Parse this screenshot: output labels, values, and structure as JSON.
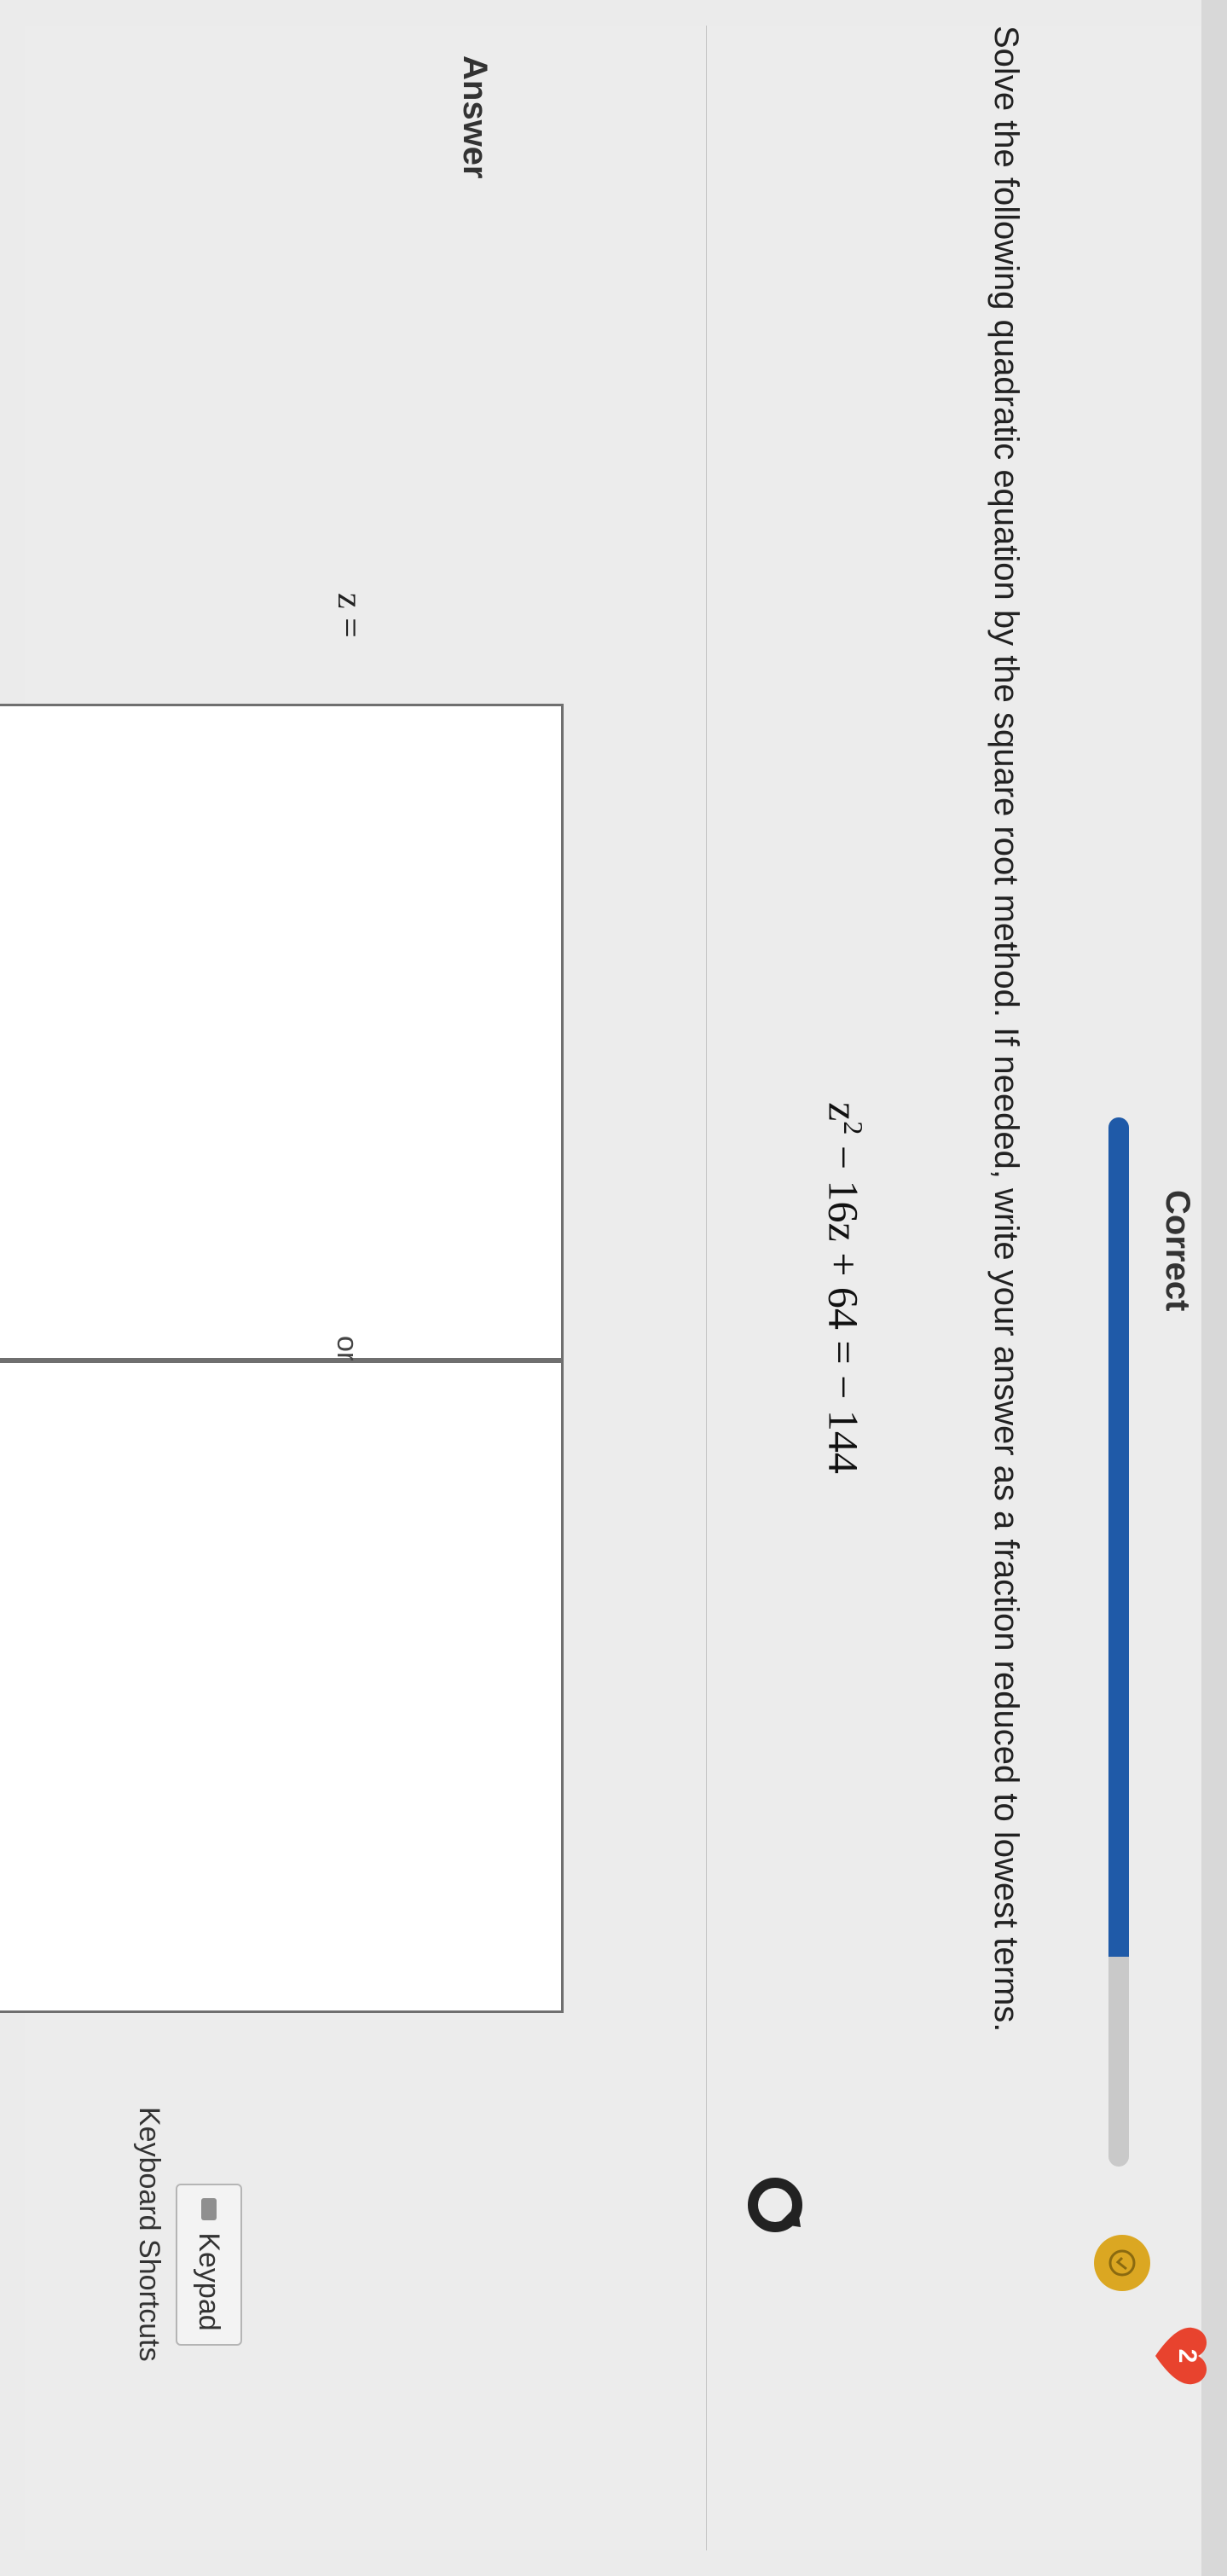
{
  "header": {
    "status": "Correct",
    "progress": 0.8,
    "heart_count": "2",
    "colors": {
      "progress_fill": "#1f5aa8",
      "badge": "#dba722",
      "heart": "#e8432e"
    }
  },
  "question": {
    "text": "Solve the following quadratic equation by the square root method. If needed, write your answer as a fraction reduced to lowest terms.",
    "equation": {
      "base": "z",
      "exponent": "2",
      "rest": " − 16z + 64 = − 144"
    }
  },
  "answer": {
    "label": "Answer",
    "variable_label": "z =",
    "separator": "or",
    "input1_value": "",
    "input2_value": ""
  },
  "tools": {
    "keypad_label": "Keypad",
    "shortcuts_label": "Keyboard Shortcuts"
  },
  "icons": {
    "badge": "medal-icon",
    "heart": "heart-icon",
    "cursor": "loading-cursor-icon",
    "keypad": "keypad-icon"
  }
}
